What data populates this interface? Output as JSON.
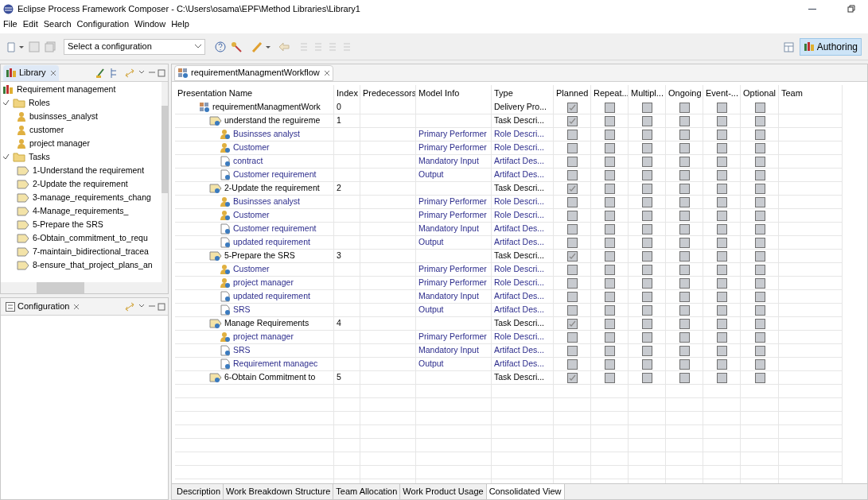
{
  "window": {
    "title": "Eclipse Process Framework Composer - C:\\Users\\osama\\EPF\\Method Libraries\\Library1"
  },
  "menu": [
    "File",
    "Edit",
    "Search",
    "Configuration",
    "Window",
    "Help"
  ],
  "toolbar": {
    "configuration": {
      "value": "Select a configuration"
    },
    "perspective": {
      "label": "Authoring",
      "selected": true
    }
  },
  "library_view": {
    "title": "Library",
    "tree": [
      {
        "label": "Requirement management",
        "kind": "library",
        "children": [
          {
            "label": "Roles",
            "kind": "folder",
            "expanded": true,
            "children": [
              {
                "label": "businsses_analyst",
                "kind": "role"
              },
              {
                "label": "customer",
                "kind": "role"
              },
              {
                "label": "project manager",
                "kind": "role"
              }
            ]
          },
          {
            "label": "Tasks",
            "kind": "folder",
            "expanded": true,
            "children": [
              {
                "label": "1-Understand the requirement",
                "kind": "task"
              },
              {
                "label": "2-Update the requirement",
                "kind": "task"
              },
              {
                "label": "3-manage_requirements_chang",
                "kind": "task"
              },
              {
                "label": "4-Manage_requirements_",
                "kind": "task"
              },
              {
                "label": "5-Prepare the SRS",
                "kind": "task"
              },
              {
                "label": "6-Obtain_commitment_to_requ",
                "kind": "task"
              },
              {
                "label": "7-maintain_bidirectional_tracea",
                "kind": "task"
              },
              {
                "label": "8-ensure_that_project_plans_an",
                "kind": "task"
              }
            ]
          }
        ]
      }
    ]
  },
  "configuration_view": {
    "title": "Configuration"
  },
  "editor": {
    "tab": "requirementManagmentWorkflow",
    "columns": [
      "Presentation Name",
      "Index",
      "Predecessors",
      "Model Info",
      "Type",
      "Planned",
      "Repeat...",
      "Multipl...",
      "Ongoing",
      "Event-...",
      "Optional",
      "Team"
    ],
    "rows": [
      {
        "name": "requirementManagmentWork",
        "kind": "process",
        "index": "0",
        "type": "Delivery Pro...",
        "checks": [
          true,
          false,
          false,
          false,
          false,
          false
        ],
        "children": [
          {
            "name": "understand the reguireme",
            "kind": "task",
            "index": "1",
            "type": "Task Descri...",
            "checks": [
              true,
              false,
              false,
              false,
              false,
              false
            ],
            "children": [
              {
                "name": "Businsses analyst",
                "kind": "role",
                "model_info": "Primary Performer",
                "type": "Role Descri...",
                "checks": [
                  false,
                  false,
                  false,
                  false,
                  false,
                  false
                ]
              },
              {
                "name": "Customer",
                "kind": "role",
                "model_info": "Primary Performer",
                "type": "Role Descri...",
                "checks": [
                  false,
                  false,
                  false,
                  false,
                  false,
                  false
                ]
              },
              {
                "name": "contract",
                "kind": "artifact",
                "model_info": "Mandatory Input",
                "type": "Artifact Des...",
                "checks": [
                  false,
                  false,
                  false,
                  false,
                  false,
                  false
                ]
              },
              {
                "name": "Customer requirement",
                "kind": "artifact",
                "model_info": "Output",
                "type": "Artifact Des...",
                "checks": [
                  false,
                  false,
                  false,
                  false,
                  false,
                  false
                ]
              }
            ]
          },
          {
            "name": "2-Update the requirement",
            "kind": "task",
            "index": "2",
            "type": "Task Descri...",
            "checks": [
              true,
              false,
              false,
              false,
              false,
              false
            ],
            "children": [
              {
                "name": "Businsses analyst",
                "kind": "role",
                "model_info": "Primary Performer",
                "type": "Role Descri...",
                "checks": [
                  false,
                  false,
                  false,
                  false,
                  false,
                  false
                ]
              },
              {
                "name": "Customer",
                "kind": "role",
                "model_info": "Primary Performer",
                "type": "Role Descri...",
                "checks": [
                  false,
                  false,
                  false,
                  false,
                  false,
                  false
                ]
              },
              {
                "name": "Customer requirement",
                "kind": "artifact",
                "model_info": "Mandatory Input",
                "type": "Artifact Des...",
                "checks": [
                  false,
                  false,
                  false,
                  false,
                  false,
                  false
                ]
              },
              {
                "name": "updated requirement",
                "kind": "artifact",
                "model_info": "Output",
                "type": "Artifact Des...",
                "checks": [
                  false,
                  false,
                  false,
                  false,
                  false,
                  false
                ]
              }
            ]
          },
          {
            "name": "5-Prepare the SRS",
            "kind": "task",
            "index": "3",
            "type": "Task Descri...",
            "checks": [
              true,
              false,
              false,
              false,
              false,
              false
            ],
            "children": [
              {
                "name": "Customer",
                "kind": "role",
                "model_info": "Primary Performer",
                "type": "Role Descri...",
                "checks": [
                  false,
                  false,
                  false,
                  false,
                  false,
                  false
                ]
              },
              {
                "name": "project manager",
                "kind": "role",
                "model_info": "Primary Performer",
                "type": "Role Descri...",
                "checks": [
                  false,
                  false,
                  false,
                  false,
                  false,
                  false
                ]
              },
              {
                "name": "updated requirement",
                "kind": "artifact",
                "model_info": "Mandatory Input",
                "type": "Artifact Des...",
                "checks": [
                  false,
                  false,
                  false,
                  false,
                  false,
                  false
                ]
              },
              {
                "name": "SRS",
                "kind": "artifact",
                "model_info": "Output",
                "type": "Artifact Des...",
                "checks": [
                  false,
                  false,
                  false,
                  false,
                  false,
                  false
                ]
              }
            ]
          },
          {
            "name": "Manage Requirements",
            "kind": "task",
            "index": "4",
            "type": "Task Descri...",
            "checks": [
              true,
              false,
              false,
              false,
              false,
              false
            ],
            "children": [
              {
                "name": "project manager",
                "kind": "role",
                "model_info": "Primary Performer",
                "type": "Role Descri...",
                "checks": [
                  false,
                  false,
                  false,
                  false,
                  false,
                  false
                ]
              },
              {
                "name": "SRS",
                "kind": "artifact",
                "model_info": "Mandatory Input",
                "type": "Artifact Des...",
                "checks": [
                  false,
                  false,
                  false,
                  false,
                  false,
                  false
                ]
              },
              {
                "name": "Requirement managec",
                "kind": "artifact",
                "model_info": "Output",
                "type": "Artifact Des...",
                "checks": [
                  false,
                  false,
                  false,
                  false,
                  false,
                  false
                ]
              }
            ]
          },
          {
            "name": "6-Obtain Commitment to",
            "kind": "task",
            "index": "5",
            "type": "Task Descri...",
            "checks": [
              true,
              false,
              false,
              false,
              false,
              false
            ]
          }
        ]
      }
    ],
    "bottom_tabs": [
      {
        "label": "Description",
        "selected": false
      },
      {
        "label": "Work Breakdown Structure",
        "selected": false
      },
      {
        "label": "Team Allocation",
        "selected": false
      },
      {
        "label": "Work Product Usage",
        "selected": false
      },
      {
        "label": "Consolidated View",
        "selected": true
      }
    ]
  }
}
